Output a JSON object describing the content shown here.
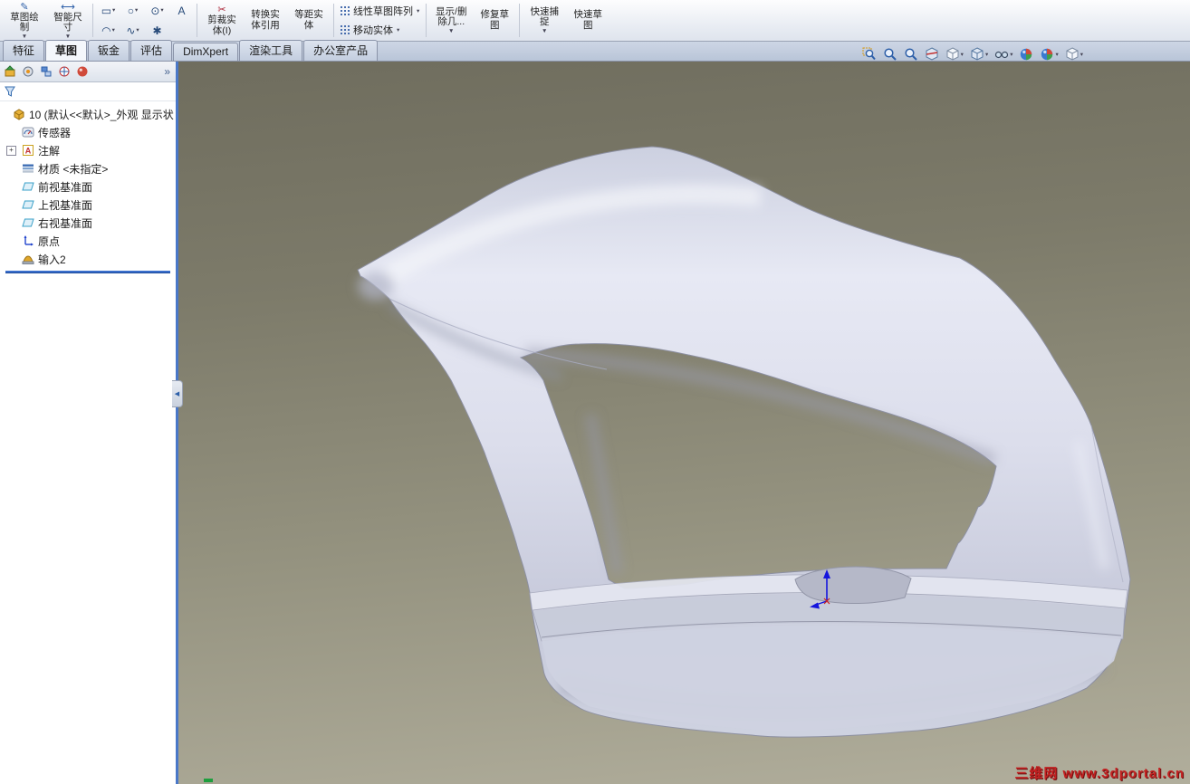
{
  "toolbar": {
    "sketch": "草图绘\n制",
    "smart_dimension": "智能尺\n寸",
    "trim": "剪裁实\n体(I)",
    "convert": "转换实\n体引用",
    "offset": "等距实\n体",
    "linear_pattern": "线性草图阵列",
    "move_entities": "移动实体",
    "display_delete": "显示/删\n除几...",
    "repair": "修复草\n图",
    "quick_snap": "快速捕\n捉",
    "rapid_sketch": "快速草\n图",
    "shape_tools": {
      "rectangle": "▭",
      "circle": "○",
      "centerpoint_circle": "⊙",
      "text": "A",
      "arc": "◠",
      "spline": "∿",
      "point": "✱"
    }
  },
  "tabs": [
    {
      "label": "特征"
    },
    {
      "label": "草图"
    },
    {
      "label": "钣金"
    },
    {
      "label": "评估"
    },
    {
      "label": "DimXpert"
    },
    {
      "label": "渲染工具"
    },
    {
      "label": "办公室产品"
    }
  ],
  "tree": {
    "root": "10 (默认<<默认>_外观 显示状",
    "items": [
      {
        "label": "传感器"
      },
      {
        "label": "注解"
      },
      {
        "label": "材质 <未指定>"
      },
      {
        "label": "前视基准面"
      },
      {
        "label": "上视基准面"
      },
      {
        "label": "右视基准面"
      },
      {
        "label": "原点"
      },
      {
        "label": "输入2"
      }
    ]
  },
  "panel": {
    "chevron": "»"
  },
  "watermark": "三维网 www.3dportal.cn"
}
